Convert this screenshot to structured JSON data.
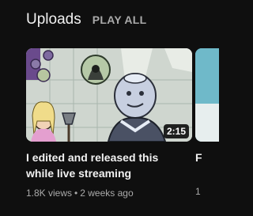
{
  "section": {
    "title": "Uploads",
    "play_all_label": "PLAY ALL"
  },
  "videos": [
    {
      "title": "I edited and released this while live streaming",
      "duration": "2:15",
      "views": "1.8K views",
      "separator": "•",
      "age": "2 weeks ago"
    }
  ],
  "next_video_peek": {
    "title_fragment": "F",
    "meta_fragment": "1"
  }
}
